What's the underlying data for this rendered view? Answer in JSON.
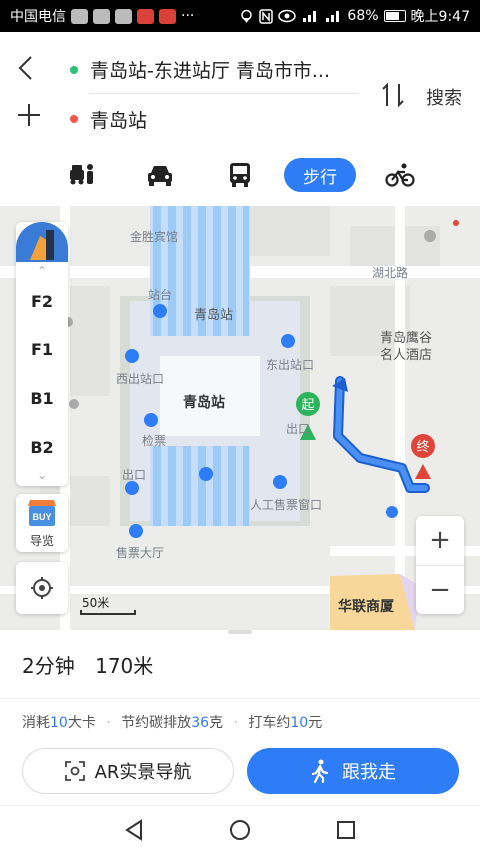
{
  "status_bar": {
    "carrier": "中国电信",
    "battery": "68%",
    "time": "晚上9:47",
    "dots": "···"
  },
  "route": {
    "from": "青岛站-东进站厅 青岛市市...",
    "to": "青岛站",
    "search_label": "搜索"
  },
  "modes": {
    "walk_label": "步行",
    "active": "walk"
  },
  "map": {
    "labels": {
      "station_main": "青岛站",
      "station_top": "青岛站",
      "platform": "站台",
      "west_exit": "西出站口",
      "east_exit": "东出站口",
      "ticket_check": "检票",
      "exit": "出口",
      "exit2": "出口",
      "manual_ticket": "人工售票窗口",
      "ticket_hall": "售票大厅",
      "jinsheng": "金胜宾馆",
      "road_hubei": "湖北路",
      "hotel": "青岛鹰谷\n名人酒店",
      "mall": "华联商厦",
      "start_pin": "起",
      "end_pin": "终"
    },
    "floors": [
      "F2",
      "F1",
      "B1",
      "B2"
    ],
    "guide_label": "导览",
    "guide_badge": "BUY",
    "scale_label": "50米",
    "zoom_in": "+",
    "zoom_out": "−",
    "route_color": "#2e7cf6"
  },
  "summary": {
    "duration": "2分钟",
    "distance": "170米",
    "calorie_prefix": "消耗",
    "calorie_value": "10",
    "calorie_unit": "大卡",
    "carbon_prefix": "节约碳排放",
    "carbon_value": "36",
    "carbon_unit": "克",
    "taxi_prefix": "打车约",
    "taxi_value": "10",
    "taxi_unit": "元"
  },
  "actions": {
    "ar_label": "AR实景导航",
    "follow_label": "跟我走"
  }
}
